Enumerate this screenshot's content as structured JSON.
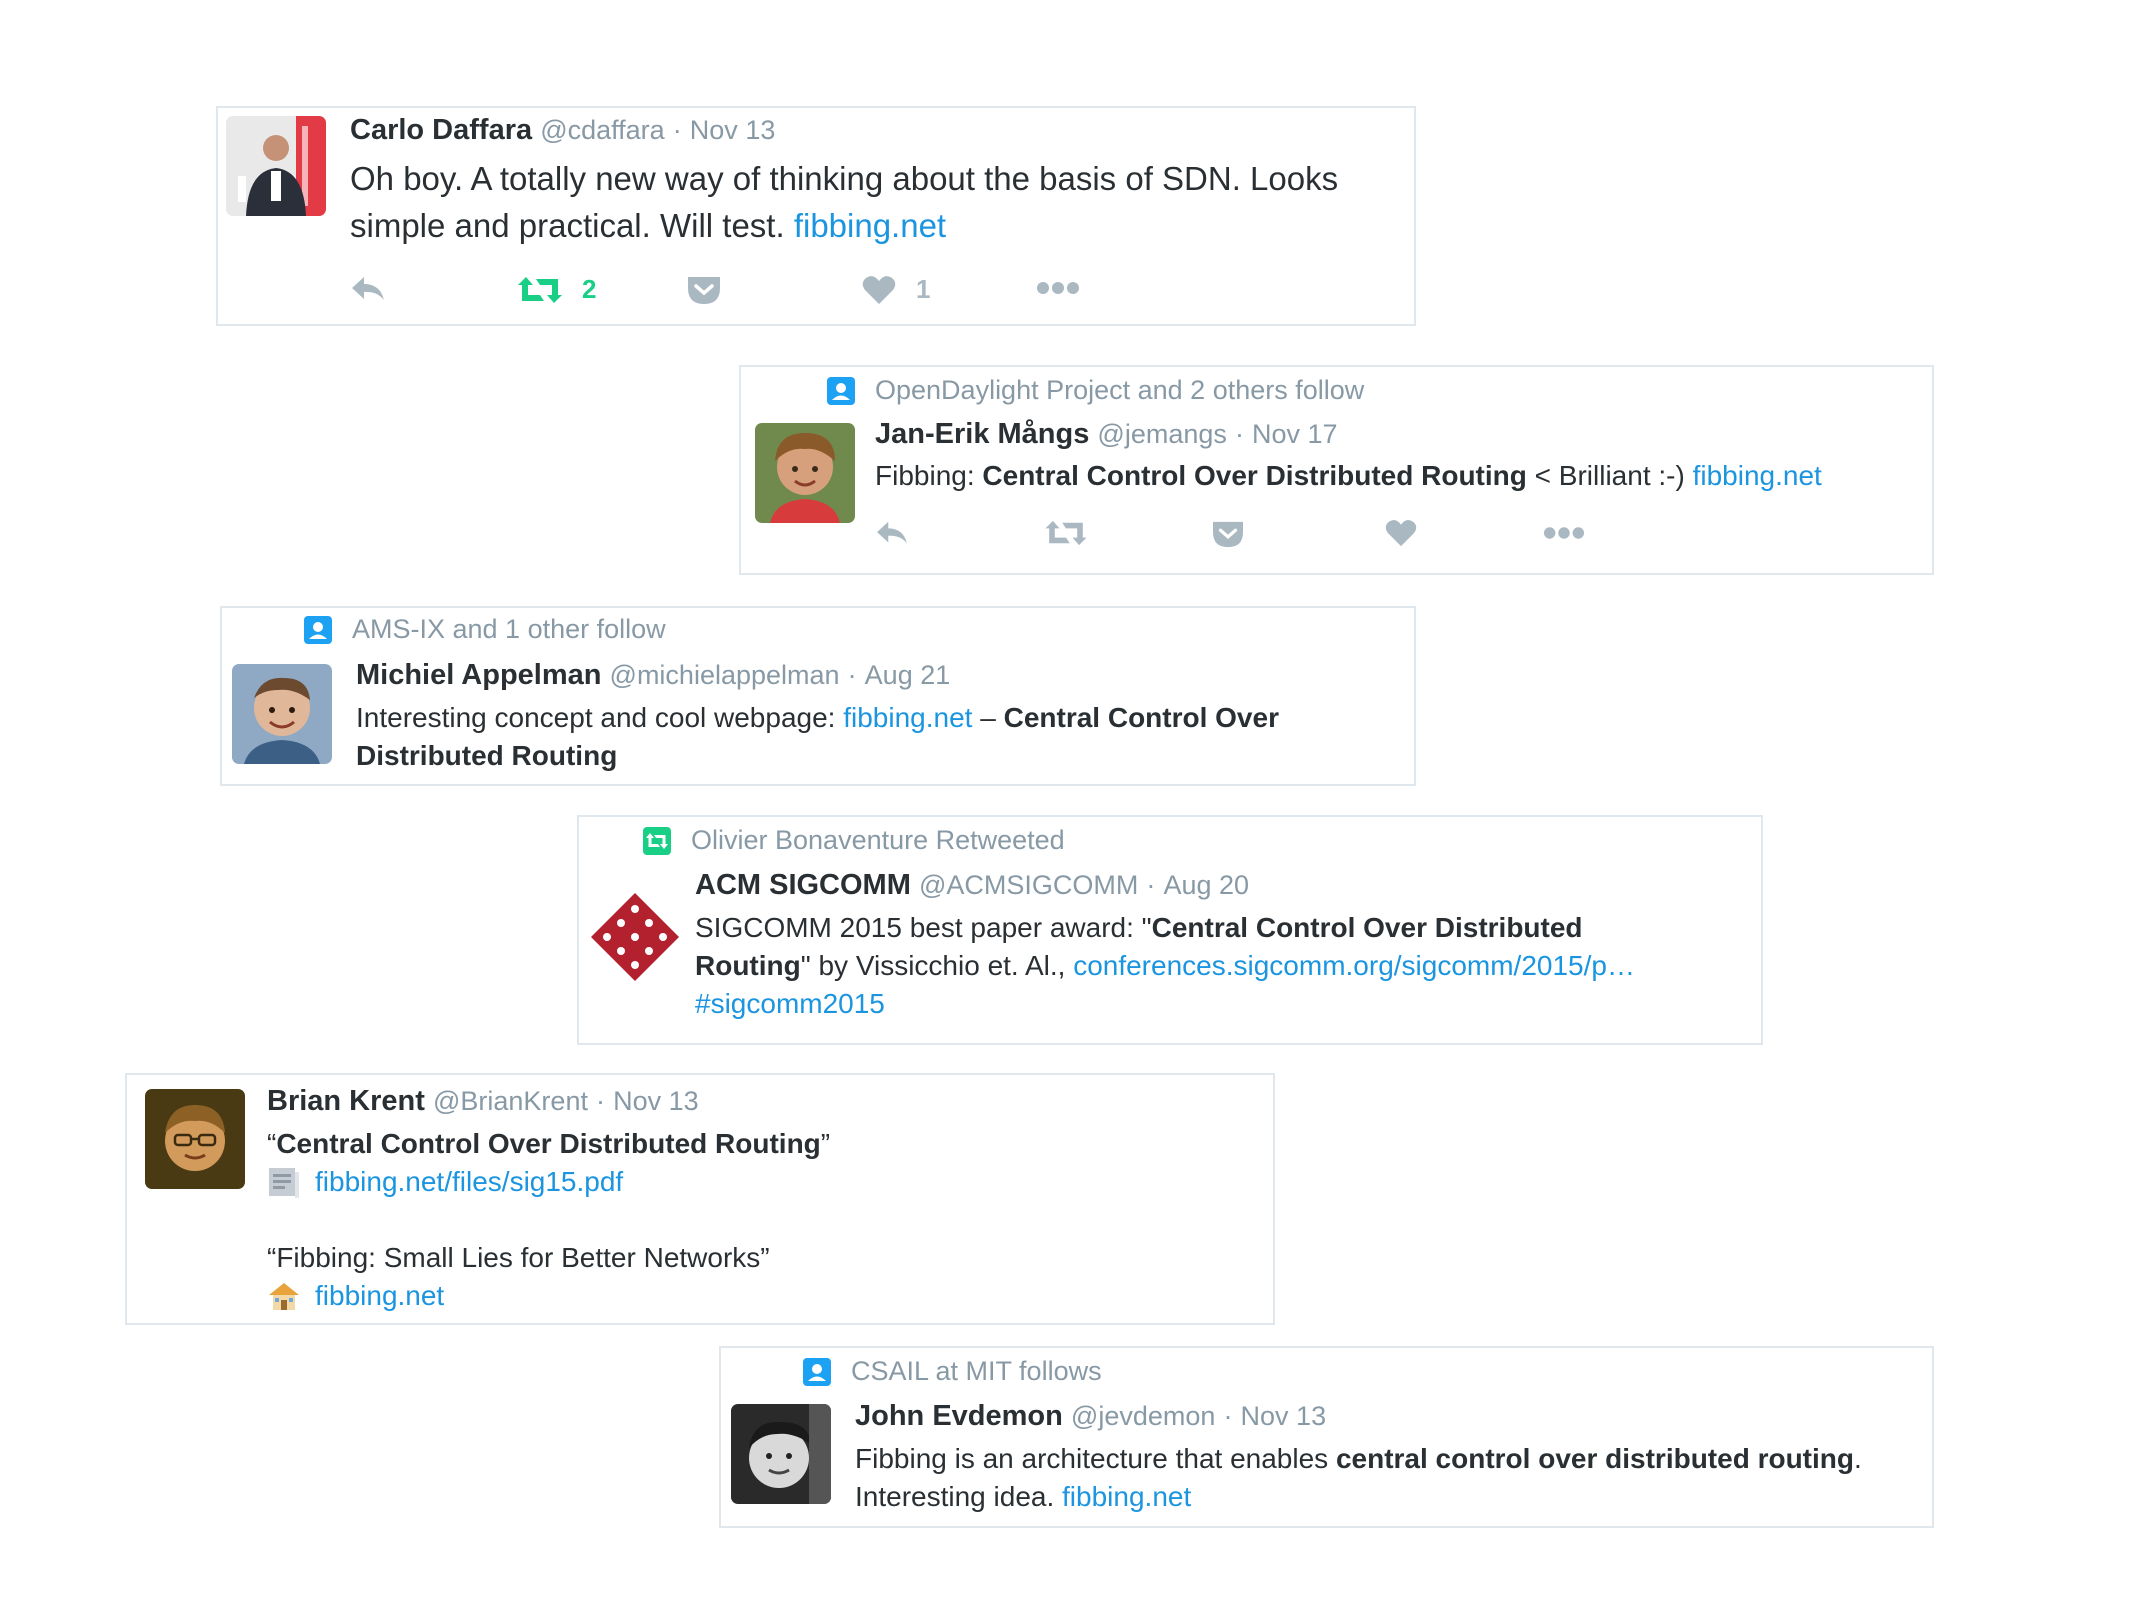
{
  "colors": {
    "link": "#1b95e0",
    "meta": "#8899a6",
    "retweet_green": "#19cf86",
    "action_grey": "#aab8c2",
    "border": "#e1e8ed"
  },
  "tweets": [
    {
      "author": "Carlo Daffara",
      "handle": "@cdaffara",
      "date": "Nov 13",
      "text1": "Oh boy. A totally new way of thinking about the basis of SDN. Looks",
      "text2": "simple and practical. Will test. ",
      "link": "fibbing.net",
      "retweet_count": "2",
      "like_count": "1",
      "icons": [
        "reply-icon",
        "retweet-icon",
        "pocket-icon",
        "heart-icon",
        "more-icon"
      ]
    },
    {
      "context": "OpenDaylight Project and 2 others follow",
      "author": "Jan-Erik Mångs",
      "handle": "@jemangs",
      "date": "Nov 17",
      "text_a": "Fibbing: ",
      "text_bold": "Central Control Over Distributed Routing",
      "text_b": " < Brilliant :-) ",
      "link": "fibbing.net",
      "icons": [
        "reply-icon",
        "retweet-icon",
        "pocket-icon",
        "heart-icon",
        "more-icon"
      ]
    },
    {
      "context": "AMS-IX and 1 other follow",
      "author": "Michiel Appelman",
      "handle": "@michielappelman",
      "date": "Aug 21",
      "text_a": "Interesting concept and cool webpage: ",
      "link": "fibbing.net",
      "text_b": " – ",
      "text_bold1": "Central Control Over",
      "text_bold2": "Distributed Routing"
    },
    {
      "context": "Olivier Bonaventure Retweeted",
      "author": "ACM SIGCOMM",
      "handle": "@ACMSIGCOMM",
      "date": "Aug 20",
      "text_a": "SIGCOMM 2015 best paper award: \"",
      "text_bold1": "Central Control Over Distributed",
      "text_bold2": "Routing",
      "text_b": "\" by Vissicchio et. Al., ",
      "link": "conferences.sigcomm.org/sigcomm/2015/p…",
      "hashtag": "#sigcomm2015"
    },
    {
      "author": "Brian Krent",
      "handle": "@BrianKrent",
      "date": "Nov 13",
      "quote1_open": "“",
      "quote1": "Central Control Over Distributed Routing",
      "quote1_close": "”",
      "link1": "fibbing.net/files/sig15.pdf",
      "quote2": "“Fibbing: Small Lies for Better Networks”",
      "link2": "fibbing.net",
      "icons": [
        "document-icon",
        "house-icon"
      ]
    },
    {
      "context": "CSAIL at MIT follows",
      "author": "John Evdemon",
      "handle": "@jevdemon",
      "date": "Nov 13",
      "text_a": "Fibbing is an architecture that enables ",
      "text_bold": "central control over distributed routing",
      "text_b": ".",
      "text2": "Interesting idea. ",
      "link": "fibbing.net"
    }
  ]
}
